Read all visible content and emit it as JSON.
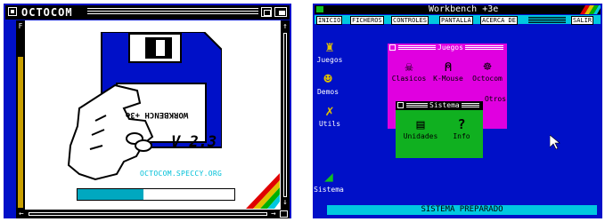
{
  "left": {
    "window_title": "OCTOCOM",
    "disk_label": "WORKBENCH +3e",
    "version": "V 2.3",
    "url": "OCTOCOM.SPECCY.ORG",
    "progress": 0.42,
    "scroll_up": "↑",
    "scroll_down": "↓",
    "scroll_left": "←",
    "scroll_right": "→"
  },
  "right": {
    "window_title": "Workbench +3e",
    "menu": [
      "INICIO",
      "FICHEROS",
      "CONTROLES",
      "PANTALLA",
      "ACERCA DE",
      "SALIR"
    ],
    "desktop_icons": [
      {
        "label": "Juegos",
        "icon": "joystick-icon"
      },
      {
        "label": "Demos",
        "icon": "demos-icon"
      },
      {
        "label": "Utils",
        "icon": "tools-icon"
      },
      {
        "label": "Sistema",
        "icon": "system-icon"
      }
    ],
    "juegos_window": {
      "title": "Juegos",
      "items": [
        {
          "label": "Clasicos",
          "icon": "ghost-icon"
        },
        {
          "label": "K-Mouse",
          "icon": "mouse-icon"
        },
        {
          "label": "Octocom",
          "icon": "octopus-icon"
        },
        {
          "label": "Otros",
          "icon": "misc-icon"
        }
      ]
    },
    "sistema_window": {
      "title": "Sistema",
      "items": [
        {
          "label": "Unidades",
          "icon": "drive-icon"
        },
        {
          "label": "Info",
          "icon": "question-icon"
        }
      ]
    },
    "status": "SISTEMA PREPARADO"
  },
  "colors": {
    "blue": "#0010c8",
    "cyan": "#00c8e0",
    "magenta": "#e000e0",
    "green": "#10b020",
    "yellow": "#c9a000"
  }
}
